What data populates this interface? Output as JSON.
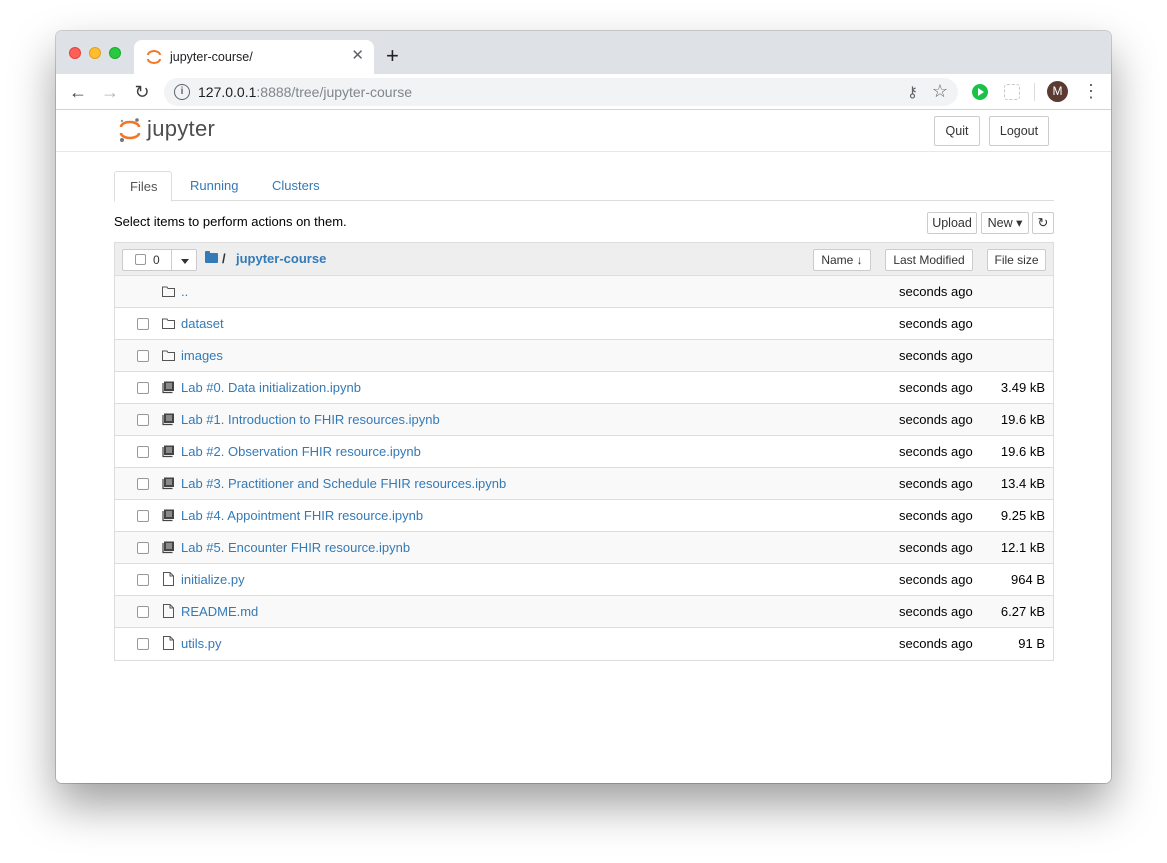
{
  "browser": {
    "tab_title": "jupyter-course/",
    "tab_close": "✕",
    "new_tab": "+",
    "url_host": "127.0.0.1",
    "url_rest": ":8888/tree/jupyter-course",
    "avatar_letter": "M"
  },
  "header": {
    "logo_text": "jupyter",
    "quit_label": "Quit",
    "logout_label": "Logout"
  },
  "tabs": [
    {
      "label": "Files"
    },
    {
      "label": "Running"
    },
    {
      "label": "Clusters"
    }
  ],
  "actions": {
    "hint": "Select items to perform actions on them.",
    "upload_label": "Upload",
    "new_label": "New ▾",
    "refresh_icon": "↻"
  },
  "list_header": {
    "selected_count": "0",
    "breadcrumb_slash": "/",
    "folder_name": "jupyter-course",
    "name_label": "Name ↓",
    "modified_label": "Last Modified",
    "size_label": "File size"
  },
  "files": [
    {
      "name": "..",
      "type": "folder",
      "modified": "seconds ago",
      "size": ""
    },
    {
      "name": "dataset",
      "type": "folder",
      "modified": "seconds ago",
      "size": ""
    },
    {
      "name": "images",
      "type": "folder",
      "modified": "seconds ago",
      "size": ""
    },
    {
      "name": "Lab #0. Data initialization.ipynb",
      "type": "notebook",
      "modified": "seconds ago",
      "size": "3.49 kB"
    },
    {
      "name": "Lab #1. Introduction to FHIR resources.ipynb",
      "type": "notebook",
      "modified": "seconds ago",
      "size": "19.6 kB"
    },
    {
      "name": "Lab #2. Observation FHIR resource.ipynb",
      "type": "notebook",
      "modified": "seconds ago",
      "size": "19.6 kB"
    },
    {
      "name": "Lab #3. Practitioner and Schedule FHIR resources.ipynb",
      "type": "notebook",
      "modified": "seconds ago",
      "size": "13.4 kB"
    },
    {
      "name": "Lab #4. Appointment FHIR resource.ipynb",
      "type": "notebook",
      "modified": "seconds ago",
      "size": "9.25 kB"
    },
    {
      "name": "Lab #5. Encounter FHIR resource.ipynb",
      "type": "notebook",
      "modified": "seconds ago",
      "size": "12.1 kB"
    },
    {
      "name": "initialize.py",
      "type": "file",
      "modified": "seconds ago",
      "size": "964 B"
    },
    {
      "name": "README.md",
      "type": "file",
      "modified": "seconds ago",
      "size": "6.27 kB"
    },
    {
      "name": "utils.py",
      "type": "file",
      "modified": "seconds ago",
      "size": "91 B"
    }
  ],
  "colors": {
    "link": "#337ab7",
    "jupyter_orange": "#f37626"
  }
}
